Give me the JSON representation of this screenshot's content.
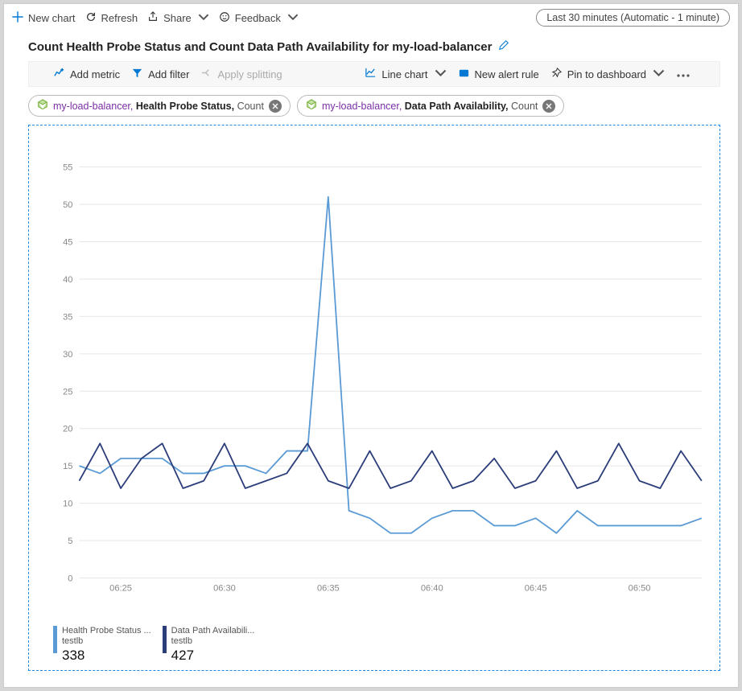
{
  "topbar": {
    "new_chart": "New chart",
    "refresh": "Refresh",
    "share": "Share",
    "feedback": "Feedback",
    "time_range": "Last 30 minutes (Automatic - 1 minute)"
  },
  "title": "Count Health Probe Status and Count Data Path Availability for my-load-balancer",
  "chartbar": {
    "add_metric": "Add metric",
    "add_filter": "Add filter",
    "apply_splitting": "Apply splitting",
    "line_chart": "Line chart",
    "new_alert": "New alert rule",
    "pin_dashboard": "Pin to dashboard"
  },
  "chips": [
    {
      "resource": "my-load-balancer",
      "metric": "Health Probe Status",
      "aggregation": "Count"
    },
    {
      "resource": "my-load-balancer",
      "metric": "Data Path Availability",
      "aggregation": "Count"
    }
  ],
  "legend": [
    {
      "title": "Health Probe Status ...",
      "sub": "testlb",
      "value": "338",
      "color": "#5b9bd5"
    },
    {
      "title": "Data Path Availabili...",
      "sub": "testlb",
      "value": "427",
      "color": "#2c3e7a"
    }
  ],
  "chart_data": {
    "type": "line",
    "title": "Count Health Probe Status and Count Data Path Availability for my-load-balancer",
    "xlabel": "",
    "ylabel": "",
    "ylim": [
      0,
      55
    ],
    "x_ticks": [
      "06:25",
      "06:30",
      "06:35",
      "06:40",
      "06:45",
      "06:50"
    ],
    "y_ticks": [
      0,
      5,
      10,
      15,
      20,
      25,
      30,
      35,
      40,
      45,
      50,
      55
    ],
    "series": [
      {
        "name": "Health Probe Status",
        "color": "#5b9bd5",
        "x": [
          "06:23",
          "06:24",
          "06:25",
          "06:26",
          "06:27",
          "06:28",
          "06:29",
          "06:30",
          "06:31",
          "06:32",
          "06:33",
          "06:34",
          "06:35",
          "06:36",
          "06:37",
          "06:38",
          "06:39",
          "06:40",
          "06:41",
          "06:42",
          "06:43",
          "06:44",
          "06:45",
          "06:46",
          "06:47",
          "06:48",
          "06:49",
          "06:50",
          "06:51",
          "06:52",
          "06:53"
        ],
        "values": [
          15,
          14,
          16,
          16,
          16,
          14,
          14,
          15,
          15,
          14,
          17,
          17,
          51,
          9,
          8,
          6,
          6,
          8,
          9,
          9,
          7,
          7,
          8,
          6,
          9,
          7,
          7,
          7,
          7,
          7,
          8
        ]
      },
      {
        "name": "Data Path Availability",
        "color": "#2c3e7a",
        "x": [
          "06:23",
          "06:24",
          "06:25",
          "06:26",
          "06:27",
          "06:28",
          "06:29",
          "06:30",
          "06:31",
          "06:32",
          "06:33",
          "06:34",
          "06:35",
          "06:36",
          "06:37",
          "06:38",
          "06:39",
          "06:40",
          "06:41",
          "06:42",
          "06:43",
          "06:44",
          "06:45",
          "06:46",
          "06:47",
          "06:48",
          "06:49",
          "06:50",
          "06:51",
          "06:52",
          "06:53"
        ],
        "values": [
          13,
          18,
          12,
          16,
          18,
          12,
          13,
          18,
          12,
          13,
          14,
          18,
          13,
          12,
          17,
          12,
          13,
          17,
          12,
          13,
          16,
          12,
          13,
          17,
          12,
          13,
          18,
          13,
          12,
          17,
          13
        ]
      }
    ]
  }
}
